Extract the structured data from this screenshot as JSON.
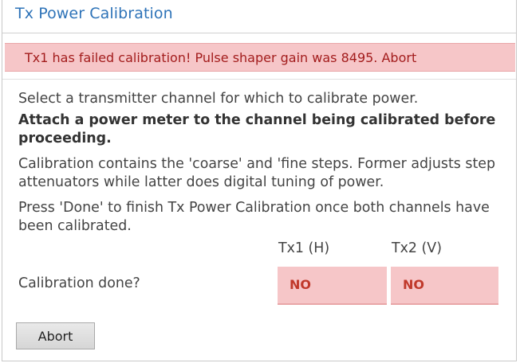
{
  "dialog": {
    "title": "Tx Power Calibration"
  },
  "alert": {
    "message": "Tx1 has failed calibration! Pulse shaper gain was 8495. Abort",
    "color": "#f6c6c8",
    "text_color": "#a31d1d"
  },
  "instructions": {
    "line1": "Select a transmitter channel for which to calibrate power.",
    "line2": "Attach a power meter to the channel being calibrated before proceeding.",
    "line3": "Calibration contains the 'coarse' and 'fine steps. Former adjusts step attenuators while latter does digital tuning of power.",
    "line4": "Press 'Done' to finish Tx Power Calibration once both channels have been calibrated."
  },
  "table": {
    "columns": [
      "Tx1 (H)",
      "Tx2 (V)"
    ],
    "row_label": "Calibration done?",
    "values": [
      "NO",
      "NO"
    ],
    "status_color": "#c0392b"
  },
  "actions": {
    "abort_label": "Abort"
  },
  "colors": {
    "title": "#2e73b8",
    "background": "#ffffff"
  }
}
